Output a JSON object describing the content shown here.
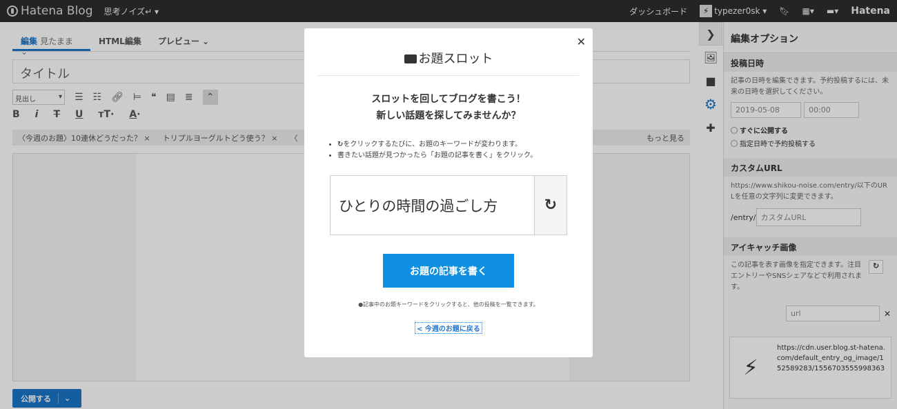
{
  "topbar": {
    "logo": "Hatena Blog",
    "blog": "思考ノイズ↵ ▾",
    "dashboard": "ダッシュボード",
    "user": "typezer0sk ▾",
    "hatena": "Hatena"
  },
  "tabs": {
    "edit": "編集",
    "mode": "見たまま ⌄",
    "html": "HTML編集",
    "preview": "プレビュー ⌄"
  },
  "title_placeholder": "タイトル",
  "toolbar": {
    "heading": "見出し"
  },
  "topics": [
    "〈今週のお題〉10連休どうだった？ ×",
    "トリプルヨーグルトどう使う？ ×",
    "〈"
  ],
  "topics_more": "もっと見る",
  "publish": "公開する",
  "panel": {
    "title": "編集オプション",
    "date_h": "投稿日時",
    "date_desc": "記事の日時を編集できます。予約投稿するには、未来の日時を選択してください。",
    "date": "2019-05-08",
    "time": "00:00",
    "now": "すぐに公開する",
    "sched": "指定日時で予約投稿する",
    "url_h": "カスタムURL",
    "url_desc": "https://www.shikou-noise.com/entry/以下のURLを任意の文字列に変更できます。",
    "url_prefix": "/entry/",
    "url_ph": "カスタムURL",
    "eye_h": "アイキャッチ画像",
    "eye_desc": "この記事を表す画像を指定できます。注目エントリーやSNSシェアなどで利用されます。",
    "eye_url": "url",
    "eye_img": "https://cdn.user.blog.st-hatena.com/default_entry_og_image/152589283/1556703555998363"
  },
  "modal": {
    "title": "お題スロット",
    "lead1": "スロットを回してブログを書こう！",
    "lead2": "新しい話題を探してみませんか？",
    "b1": "をクリックするたびに、お題のキーワードが変わります。",
    "b2": "書きたい話題が見つかったら「お題の記事を書く」をクリック。",
    "keyword": "ひとりの時間の過ごし方",
    "write": "お題の記事を書く",
    "note": "●記事中のお題キーワードをクリックすると、他の投稿を一覧できます。",
    "back": "< 今週のお題に戻る"
  }
}
